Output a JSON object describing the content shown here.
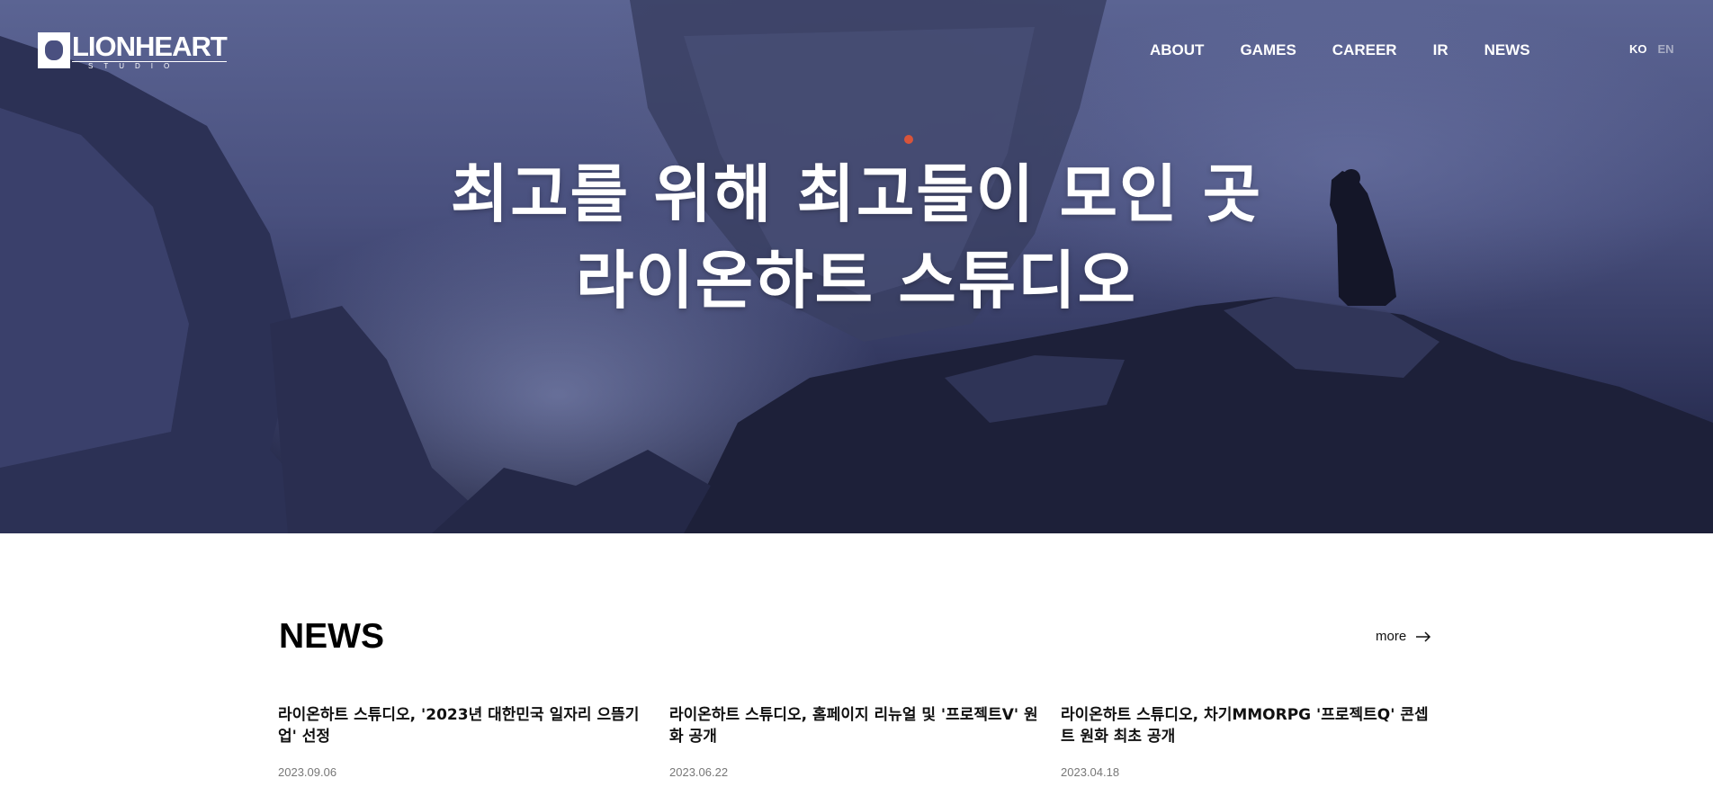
{
  "brand": {
    "logo_main": "LIONHEART",
    "logo_sub": "STUDIO"
  },
  "nav": {
    "items": [
      {
        "label": "ABOUT"
      },
      {
        "label": "GAMES"
      },
      {
        "label": "CAREER"
      },
      {
        "label": "IR"
      },
      {
        "label": "NEWS"
      }
    ]
  },
  "lang": {
    "ko": "KO",
    "en": "EN"
  },
  "hero": {
    "line1": "최고를 위해 최고들이 모인 곳",
    "line2": "라이온하트 스튜디오"
  },
  "news": {
    "title": "NEWS",
    "more_label": "more",
    "items": [
      {
        "title": "라이온하트 스튜디오, '2023년 대한민국 일자리 으뜸기업' 선정",
        "date": "2023.09.06"
      },
      {
        "title": "라이온하트 스튜디오, 홈페이지 리뉴얼 및 '프로젝트V' 원화 공개",
        "date": "2023.06.22"
      },
      {
        "title": "라이온하트 스튜디오, 차기MMORPG '프로젝트Q' 콘셉트 원화 최초 공개",
        "date": "2023.04.18"
      }
    ]
  },
  "colors": {
    "hero_top": "#5b6493",
    "hero_bottom": "#1b1e38",
    "lang_inactive": "#a9adc4",
    "date_gray": "#777777"
  }
}
